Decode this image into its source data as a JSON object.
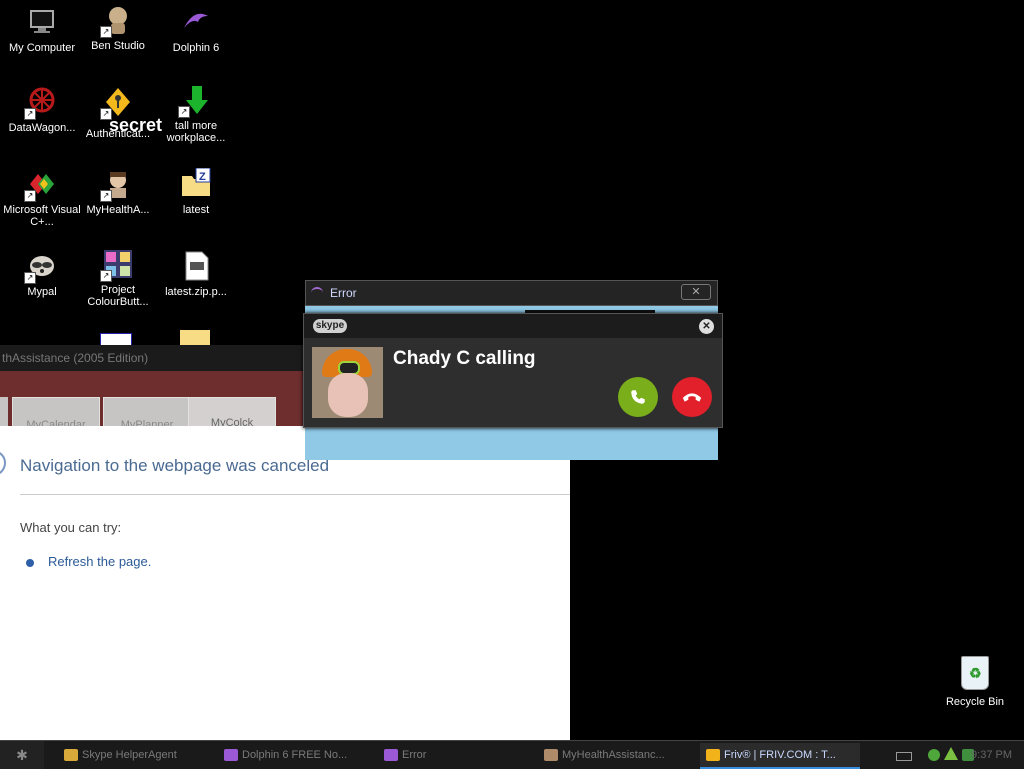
{
  "desktop": {
    "icons": [
      {
        "label": "My Computer",
        "icon": "monitor-icon"
      },
      {
        "label": "Ben Studio",
        "icon": "ben-studio-icon"
      },
      {
        "label": "Dolphin 6",
        "icon": "dolphin-icon"
      },
      {
        "label": "DataWagon...",
        "icon": "datawagon-icon"
      },
      {
        "label": "Authenticat...",
        "icon": "key-icon"
      },
      {
        "label": "tall more workplace...",
        "icon": "download-arrow-icon"
      },
      {
        "label": "Microsoft Visual C+...",
        "icon": "visual-c-icon"
      },
      {
        "label": "MyHealthA...",
        "icon": "person-icon"
      },
      {
        "label": "latest",
        "icon": "zip-folder-icon"
      },
      {
        "label": "Mypal",
        "icon": "raccoon-icon"
      },
      {
        "label": "Project ColourButt...",
        "icon": "photos-icon"
      },
      {
        "label": "latest.zip.p...",
        "icon": "document-icon"
      }
    ],
    "overlay_text": "secret",
    "recycle_bin": "Recycle Bin"
  },
  "app": {
    "title": "thAssistance (2005 Edition)",
    "tabs": [
      "MyCalendar",
      "MyPlanner",
      "MyColck"
    ],
    "nav": {
      "title": "Navigation to the webpage was canceled",
      "try": "What you can try:",
      "link": "Refresh the page."
    }
  },
  "error_window": {
    "title": "Error",
    "close": "✕"
  },
  "skype": {
    "logo": "skype",
    "caller": "Chady C calling",
    "close": "✕",
    "colors": {
      "accept": "#7aae1a",
      "decline": "#e2202b"
    }
  },
  "taskbar": {
    "items": [
      {
        "label": "Skype HelperAgent"
      },
      {
        "label": "Dolphin 6 FREE No..."
      },
      {
        "label": "Error"
      },
      {
        "label": "MyHealthAssistanc..."
      },
      {
        "label": "Friv® | FRIV.COM : T..."
      }
    ],
    "clock": "9:37 PM"
  }
}
